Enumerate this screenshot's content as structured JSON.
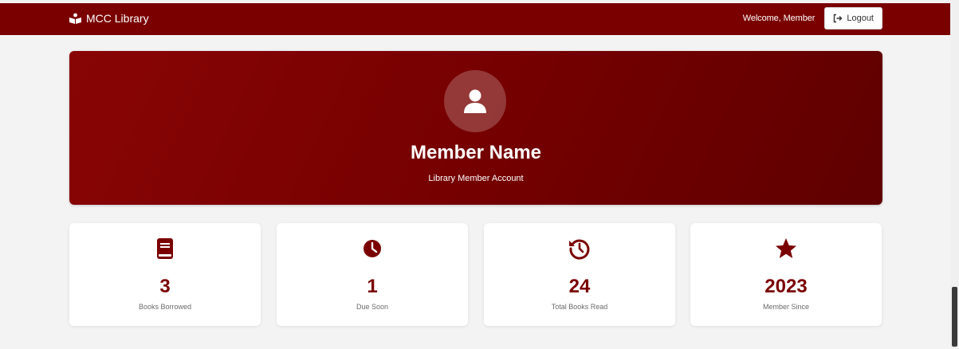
{
  "navbar": {
    "brand": "MCC Library",
    "brand_icon": "book-reader-icon",
    "welcome": "Welcome, Member",
    "logout_label": "Logout",
    "logout_icon": "sign-out-icon"
  },
  "profile": {
    "avatar_icon": "user-icon",
    "name": "Member Name",
    "subtitle": "Library Member Account"
  },
  "stats": [
    {
      "icon": "book-icon",
      "value": "3",
      "label": "Books Borrowed"
    },
    {
      "icon": "clock-icon",
      "value": "1",
      "label": "Due Soon"
    },
    {
      "icon": "history-icon",
      "value": "24",
      "label": "Total Books Read"
    },
    {
      "icon": "star-icon",
      "value": "2023",
      "label": "Member Since"
    }
  ],
  "colors": {
    "primary": "#7a0000",
    "background": "#f3f3f3",
    "card": "#ffffff"
  }
}
